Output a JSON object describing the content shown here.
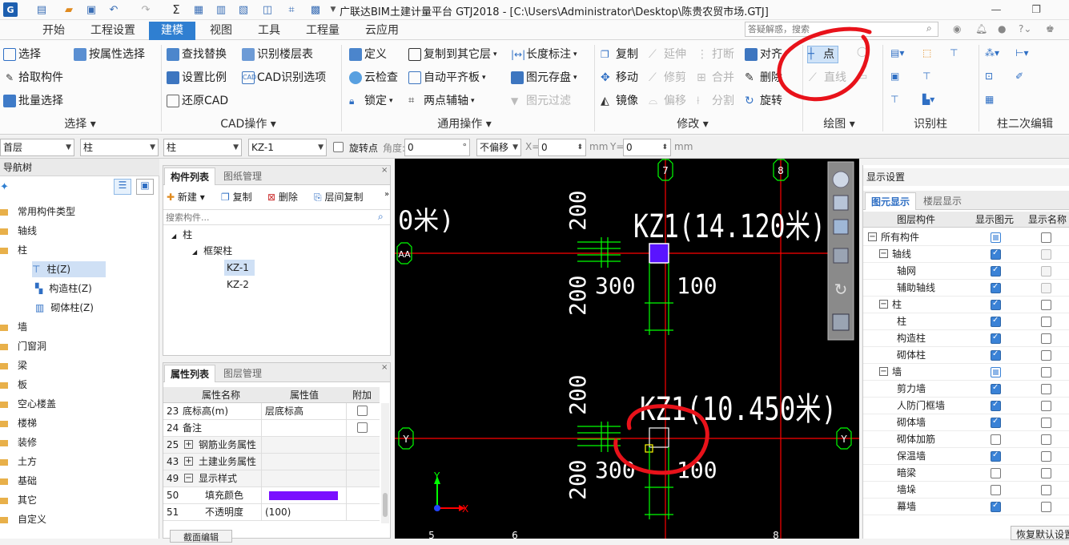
{
  "window": {
    "title": "广联达BIM土建计量平台 GTJ2018 - [C:\\Users\\Administrator\\Desktop\\陈贵农贸市场.GTJ]"
  },
  "menu": {
    "tabs": [
      "开始",
      "工程设置",
      "建模",
      "视图",
      "工具",
      "工程量",
      "云应用"
    ],
    "active": "建模",
    "search_placeholder": "答疑解惑，搜索"
  },
  "ribbon": {
    "select": {
      "items": [
        "选择",
        "按属性选择",
        "拾取构件",
        "批量选择"
      ],
      "group": "选择"
    },
    "cad": {
      "items": [
        "查找替换",
        "识别楼层表",
        "设置比例",
        "CAD识别选项",
        "还原CAD"
      ],
      "group": "CAD操作"
    },
    "general": {
      "items": [
        "定义",
        "复制到其它层",
        "长度标注",
        "云检查",
        "自动平齐板",
        "图元存盘",
        "锁定",
        "两点辅轴",
        "图元过滤"
      ],
      "group": "通用操作"
    },
    "modify": {
      "items": [
        "复制",
        "延伸",
        "打断",
        "对齐",
        "移动",
        "修剪",
        "合并",
        "删除",
        "镜像",
        "偏移",
        "分割",
        "旋转"
      ],
      "group": "修改"
    },
    "draw": {
      "items": [
        "点",
        "直线"
      ],
      "group": "绘图"
    },
    "recognize": {
      "group": "识别柱"
    },
    "column_edit": {
      "group": "柱二次编辑"
    }
  },
  "propbar": {
    "floor": "首层",
    "type": "柱",
    "subtype": "柱",
    "member": "KZ-1",
    "rotate_label": "旋转点",
    "angle_label": "角度:",
    "angle_value": "0",
    "offset": "不偏移",
    "x_label": "X=",
    "x_value": "0",
    "y_label": "Y=",
    "y_value": "0",
    "unit": "mm"
  },
  "nav_tree": {
    "title": "导航树",
    "items": [
      "常用构件类型",
      "轴线",
      "柱",
      "墙",
      "门窗洞",
      "梁",
      "板",
      "空心楼盖",
      "楼梯",
      "装修",
      "土方",
      "基础",
      "其它",
      "自定义"
    ],
    "column_children": [
      "柱(Z)",
      "构造柱(Z)",
      "砌体柱(Z)"
    ]
  },
  "component_list": {
    "tabs": [
      "构件列表",
      "图纸管理"
    ],
    "toolbar": [
      "新建",
      "复制",
      "删除",
      "层间复制"
    ],
    "search_placeholder": "搜索构件...",
    "tree": {
      "root": "柱",
      "group": "框架柱",
      "items": [
        "KZ-1",
        "KZ-2"
      ]
    }
  },
  "properties": {
    "tabs": [
      "属性列表",
      "图层管理"
    ],
    "headers": [
      "属性名称",
      "属性值",
      "附加"
    ],
    "rows": [
      {
        "no": "23",
        "name": "底标高(m)",
        "value": "层底标高"
      },
      {
        "no": "24",
        "name": "备注",
        "value": ""
      },
      {
        "no": "25",
        "name": "钢筋业务属性",
        "value": ""
      },
      {
        "no": "43",
        "name": "土建业务属性",
        "value": ""
      },
      {
        "no": "49",
        "name": "显示样式",
        "value": ""
      },
      {
        "no": "50",
        "name": "填充颜色",
        "value": ""
      },
      {
        "no": "51",
        "name": "不透明度",
        "value": "(100)"
      }
    ],
    "fill_color": "#7a10ff",
    "bottom_button": "截面编辑"
  },
  "canvas": {
    "axis_labels": {
      "top": [
        "7",
        "8"
      ],
      "left": [
        "AA",
        "Y"
      ],
      "right": [
        "Y"
      ],
      "bottom": [
        "5",
        "6",
        "8"
      ]
    },
    "upper": {
      "label": "KZ1(14.120米)",
      "left_fragment": "0米)",
      "dims": [
        "200",
        "200",
        "300",
        "100"
      ]
    },
    "lower": {
      "label": "KZ1(10.450米)",
      "dims": [
        "200",
        "200",
        "300",
        "100"
      ]
    },
    "axis_x": "X",
    "axis_y": "Y",
    "colors": {
      "grid": "#ff0000",
      "dim": "#00ff00",
      "text": "#ffffff",
      "column": "#5a14ff"
    }
  },
  "display_settings": {
    "title": "显示设置",
    "tabs": [
      "图元显示",
      "楼层显示"
    ],
    "headers": [
      "图层构件",
      "显示图元",
      "显示名称"
    ],
    "rows": [
      {
        "label": "所有构件",
        "level": 0,
        "show": "part",
        "name": "off"
      },
      {
        "label": "轴线",
        "level": 1,
        "show": "on",
        "name": "dim"
      },
      {
        "label": "轴网",
        "level": 2,
        "show": "on",
        "name": "dim"
      },
      {
        "label": "辅助轴线",
        "level": 2,
        "show": "on",
        "name": "dim"
      },
      {
        "label": "柱",
        "level": 1,
        "show": "on",
        "name": "off"
      },
      {
        "label": "柱",
        "level": 2,
        "show": "on",
        "name": "off"
      },
      {
        "label": "构造柱",
        "level": 2,
        "show": "on",
        "name": "off"
      },
      {
        "label": "砌体柱",
        "level": 2,
        "show": "on",
        "name": "off"
      },
      {
        "label": "墙",
        "level": 1,
        "show": "part",
        "name": "off"
      },
      {
        "label": "剪力墙",
        "level": 2,
        "show": "on",
        "name": "off"
      },
      {
        "label": "人防门框墙",
        "level": 2,
        "show": "on",
        "name": "off"
      },
      {
        "label": "砌体墙",
        "level": 2,
        "show": "on",
        "name": "off"
      },
      {
        "label": "砌体加筋",
        "level": 2,
        "show": "off",
        "name": "off"
      },
      {
        "label": "保温墙",
        "level": 2,
        "show": "on",
        "name": "off"
      },
      {
        "label": "暗梁",
        "level": 2,
        "show": "off",
        "name": "off"
      },
      {
        "label": "墙垛",
        "level": 2,
        "show": "off",
        "name": "off"
      },
      {
        "label": "幕墙",
        "level": 2,
        "show": "on",
        "name": "off"
      }
    ],
    "restore_button": "恢复默认设置"
  },
  "annotation": {
    "color": "#e8121a"
  }
}
